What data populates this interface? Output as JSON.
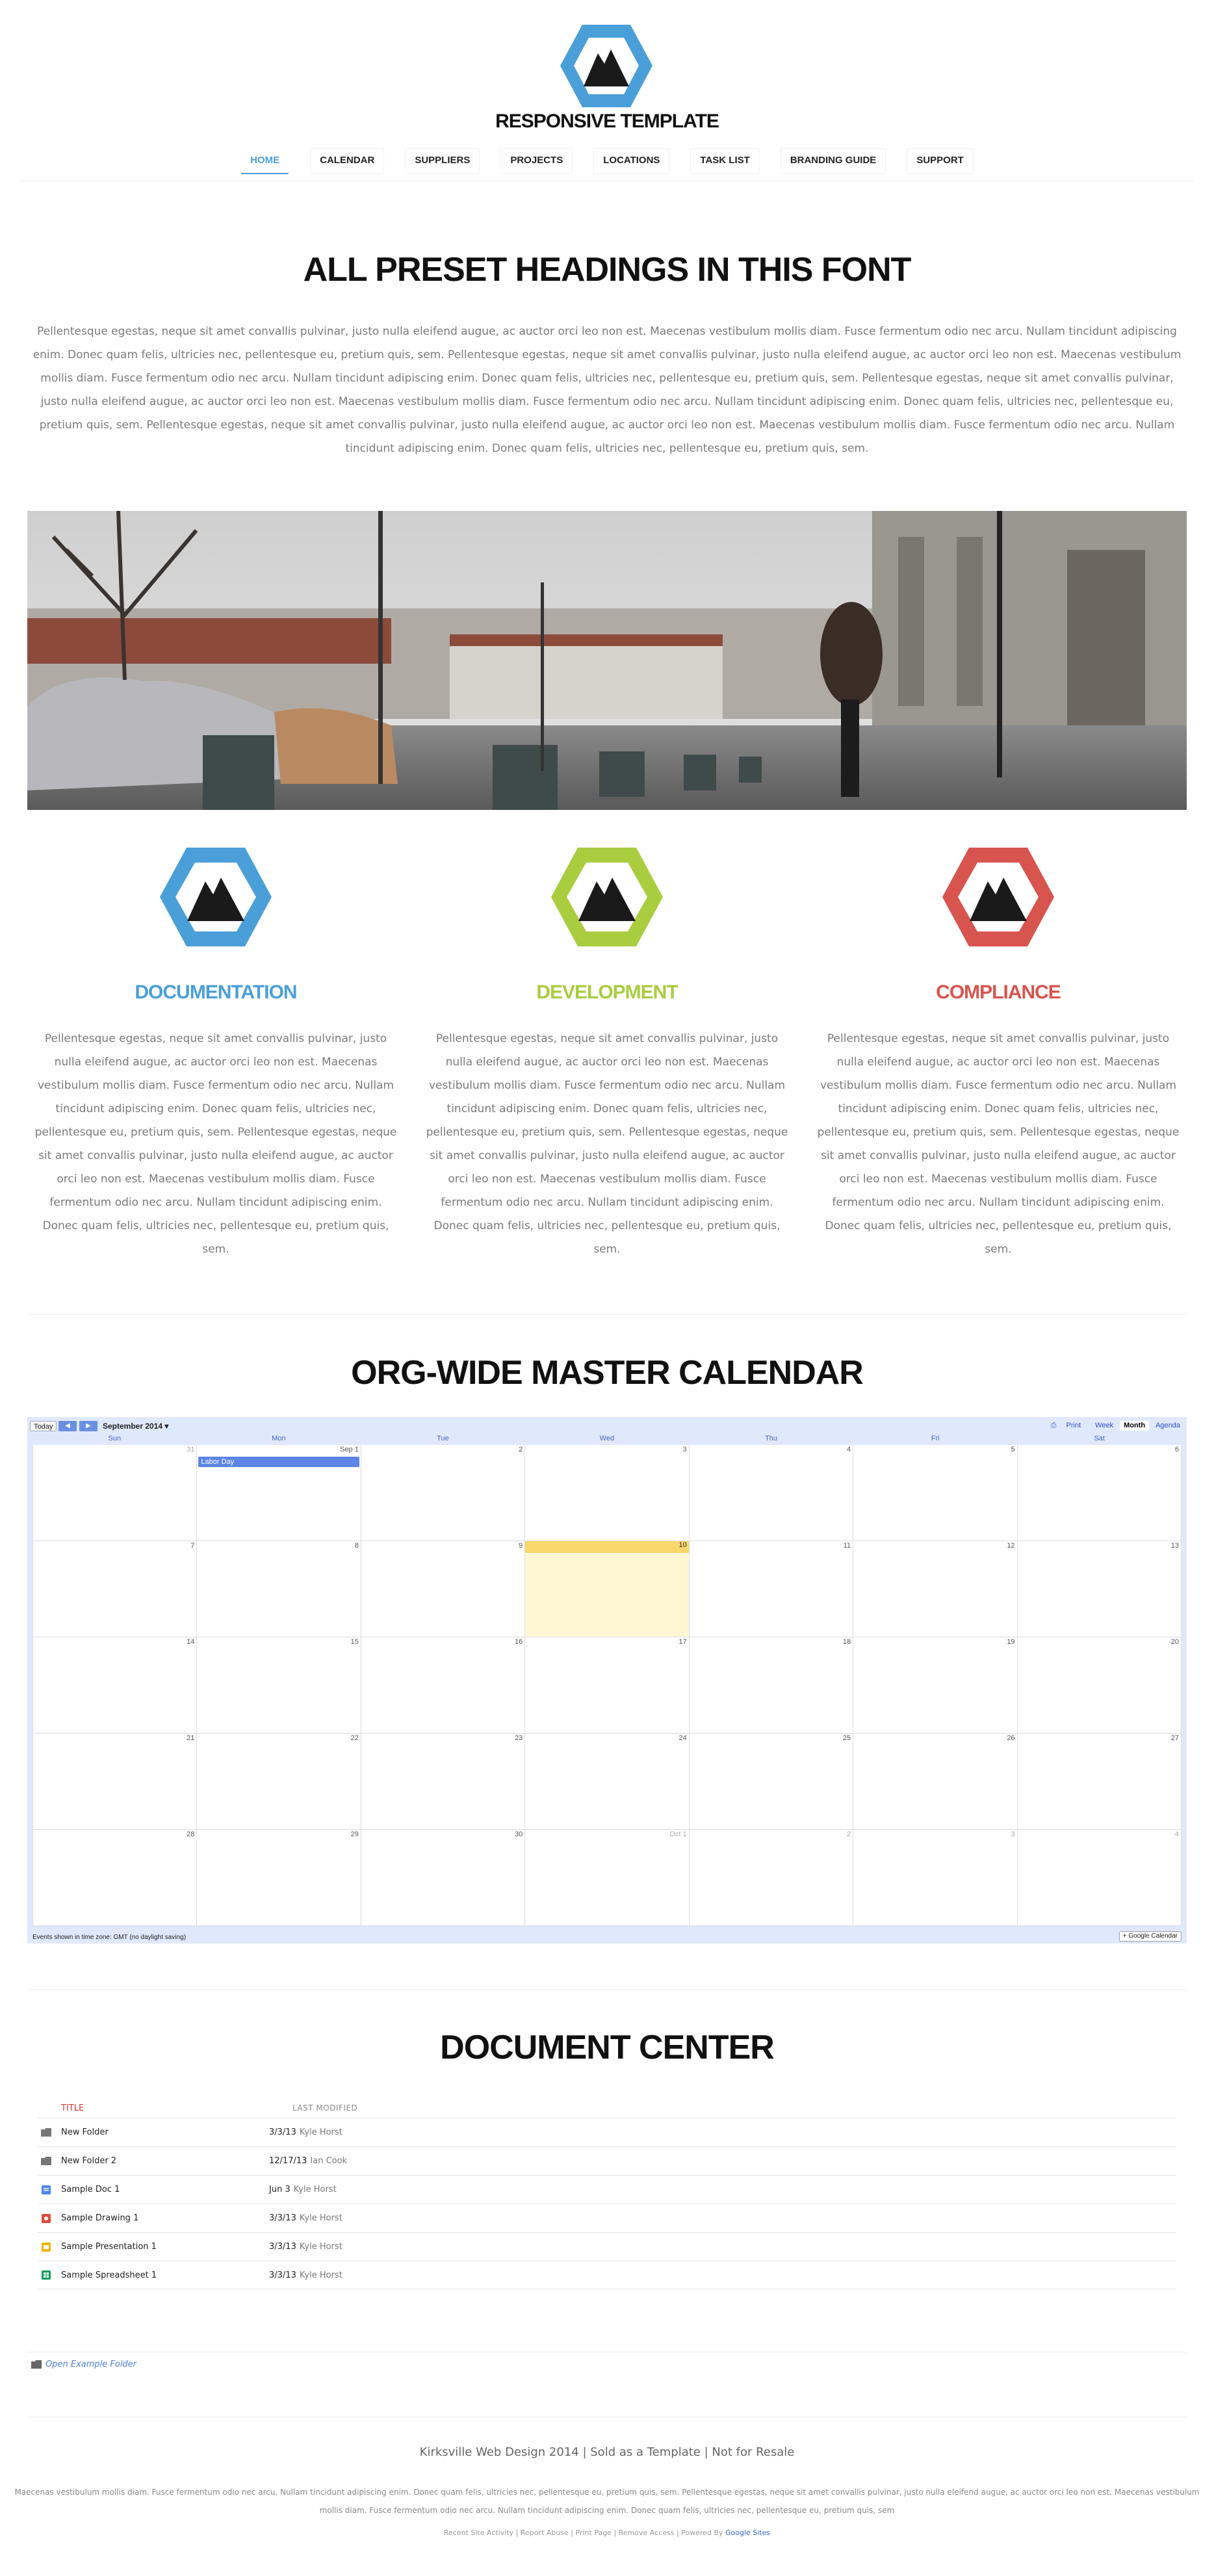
{
  "site": {
    "title": "RESPONSIVE TEMPLATE",
    "colors": {
      "blue": "#4a9fd8",
      "green": "#a9cd3f",
      "red": "#d8544e",
      "dark": "#111111"
    }
  },
  "nav": [
    {
      "label": "HOME",
      "active": true
    },
    {
      "label": "CALENDAR",
      "active": false
    },
    {
      "label": "SUPPLIERS",
      "active": false
    },
    {
      "label": "PROJECTS",
      "active": false
    },
    {
      "label": "LOCATIONS",
      "active": false
    },
    {
      "label": "TASK LIST",
      "active": false
    },
    {
      "label": "BRANDING GUIDE",
      "active": false
    },
    {
      "label": "SUPPORT",
      "active": false
    }
  ],
  "intro": {
    "heading": "ALL PRESET HEADINGS IN THIS FONT",
    "text": "Pellentesque egestas, neque sit amet convallis pulvinar, justo nulla eleifend augue, ac auctor orci leo non est. Maecenas vestibulum mollis diam. Fusce fermentum odio nec arcu. Nullam tincidunt adipiscing enim. Donec quam felis, ultricies nec, pellentesque eu, pretium quis, sem. Pellentesque egestas, neque sit amet convallis pulvinar, justo nulla eleifend augue, ac auctor orci leo non est. Maecenas vestibulum mollis diam. Fusce fermentum odio nec arcu. Nullam tincidunt adipiscing enim. Donec quam felis, ultricies nec, pellentesque eu, pretium quis, sem. Pellentesque egestas, neque sit amet convallis pulvinar, justo nulla eleifend augue, ac auctor orci leo non est. Maecenas vestibulum mollis diam. Fusce fermentum odio nec arcu. Nullam tincidunt adipiscing enim. Donec quam felis, ultricies nec, pellentesque eu, pretium quis, sem. Pellentesque egestas, neque sit amet convallis pulvinar, justo nulla eleifend augue, ac auctor orci leo non est. Maecenas vestibulum mollis diam. Fusce fermentum odio nec arcu. Nullam tincidunt adipiscing enim. Donec quam felis, ultricies nec, pellentesque eu, pretium quis, sem."
  },
  "features": [
    {
      "title": "DOCUMENTATION",
      "color": "#4a9fd8",
      "text": "Pellentesque egestas, neque sit amet convallis pulvinar, justo nulla eleifend augue, ac auctor orci leo non est. Maecenas vestibulum mollis diam. Fusce fermentum odio nec arcu. Nullam tincidunt adipiscing enim. Donec quam felis, ultricies nec, pellentesque eu, pretium quis, sem. Pellentesque egestas, neque sit amet convallis pulvinar, justo nulla eleifend augue, ac auctor orci leo non est. Maecenas vestibulum mollis diam. Fusce fermentum odio nec arcu. Nullam tincidunt adipiscing enim. Donec quam felis, ultricies nec, pellentesque eu, pretium quis, sem."
    },
    {
      "title": "DEVELOPMENT",
      "color": "#a9cd3f",
      "text": "Pellentesque egestas, neque sit amet convallis pulvinar, justo nulla eleifend augue, ac auctor orci leo non est. Maecenas vestibulum mollis diam. Fusce fermentum odio nec arcu. Nullam tincidunt adipiscing enim. Donec quam felis, ultricies nec, pellentesque eu, pretium quis, sem. Pellentesque egestas, neque sit amet convallis pulvinar, justo nulla eleifend augue, ac auctor orci leo non est. Maecenas vestibulum mollis diam. Fusce fermentum odio nec arcu. Nullam tincidunt adipiscing enim. Donec quam felis, ultricies nec, pellentesque eu, pretium quis, sem."
    },
    {
      "title": "COMPLIANCE",
      "color": "#d8544e",
      "text": "Pellentesque egestas, neque sit amet convallis pulvinar, justo nulla eleifend augue, ac auctor orci leo non est. Maecenas vestibulum mollis diam. Fusce fermentum odio nec arcu. Nullam tincidunt adipiscing enim. Donec quam felis, ultricies nec, pellentesque eu, pretium quis, sem. Pellentesque egestas, neque sit amet convallis pulvinar, justo nulla eleifend augue, ac auctor orci leo non est. Maecenas vestibulum mollis diam. Fusce fermentum odio nec arcu. Nullam tincidunt adipiscing enim. Donec quam felis, ultricies nec, pellentesque eu, pretium quis, sem."
    }
  ],
  "calendar": {
    "heading": "ORG-WIDE MASTER CALENDAR",
    "today_label": "Today",
    "month_label": "September 2014",
    "print_label": "Print",
    "views": [
      {
        "label": "Week",
        "active": false
      },
      {
        "label": "Month",
        "active": true
      },
      {
        "label": "Agenda",
        "active": false
      }
    ],
    "weekdays": [
      "Sun",
      "Mon",
      "Tue",
      "Wed",
      "Thu",
      "Fri",
      "Sat"
    ],
    "days": [
      {
        "n": "31",
        "muted": true
      },
      {
        "n": "Sep 1",
        "event": "Labor Day"
      },
      {
        "n": "2"
      },
      {
        "n": "3"
      },
      {
        "n": "4"
      },
      {
        "n": "5"
      },
      {
        "n": "6"
      },
      {
        "n": "7"
      },
      {
        "n": "8"
      },
      {
        "n": "9"
      },
      {
        "n": "10",
        "today": true
      },
      {
        "n": "11"
      },
      {
        "n": "12"
      },
      {
        "n": "13"
      },
      {
        "n": "14"
      },
      {
        "n": "15"
      },
      {
        "n": "16"
      },
      {
        "n": "17"
      },
      {
        "n": "18"
      },
      {
        "n": "19"
      },
      {
        "n": "20"
      },
      {
        "n": "21"
      },
      {
        "n": "22"
      },
      {
        "n": "23"
      },
      {
        "n": "24"
      },
      {
        "n": "25"
      },
      {
        "n": "26"
      },
      {
        "n": "27"
      },
      {
        "n": "28"
      },
      {
        "n": "29"
      },
      {
        "n": "30"
      },
      {
        "n": "Oct 1",
        "muted": true
      },
      {
        "n": "2",
        "muted": true
      },
      {
        "n": "3",
        "muted": true
      },
      {
        "n": "4",
        "muted": true
      }
    ],
    "timezone_note": "Events shown in time zone: GMT (no daylight saving)",
    "gcal_label": "Google Calendar"
  },
  "documents": {
    "heading": "DOCUMENT CENTER",
    "col_title": "TITLE",
    "col_modified": "LAST MODIFIED",
    "rows": [
      {
        "icon": "folder-icon",
        "color": "#777777",
        "name": "New Folder",
        "date": "3/3/13",
        "by": "Kyle Horst"
      },
      {
        "icon": "folder-icon",
        "color": "#777777",
        "name": "New Folder 2",
        "date": "12/17/13",
        "by": "Ian Cook"
      },
      {
        "icon": "doc-icon",
        "color": "#4a86e8",
        "name": "Sample Doc 1",
        "date": "Jun 3",
        "by": "Kyle Horst"
      },
      {
        "icon": "drawing-icon",
        "color": "#dd4b39",
        "name": "Sample Drawing 1",
        "date": "3/3/13",
        "by": "Kyle Horst"
      },
      {
        "icon": "presentation-icon",
        "color": "#f4b400",
        "name": "Sample Presentation 1",
        "date": "3/3/13",
        "by": "Kyle Horst"
      },
      {
        "icon": "spreadsheet-icon",
        "color": "#0f9d58",
        "name": "Sample Spreadsheet 1",
        "date": "3/3/13",
        "by": "Kyle Horst"
      }
    ],
    "open_folder_label": "Open Example Folder"
  },
  "footer": {
    "line": "Kirksville Web Design 2014  |  Sold as a Template  |  Not for Resale",
    "small": "Maecenas vestibulum mollis diam. Fusce fermentum odio nec arcu. Nullam tincidunt adipiscing enim. Donec quam felis, ultricies nec, pellentesque eu, pretium quis, sem. Pellentesque egestas, neque sit amet convallis pulvinar, justo nulla eleifend augue, ac auctor orci leo non est. Maecenas vestibulum mollis diam. Fusce fermentum odio nec arcu. Nullam tincidunt adipiscing enim. Donec quam felis, ultricies nec, pellentesque eu, pretium quis, sem",
    "links": [
      "Recent Site Activity",
      "Report Abuse",
      "Print Page",
      "Remove Access"
    ],
    "powered_by": "Powered By",
    "google_sites": "Google Sites"
  }
}
